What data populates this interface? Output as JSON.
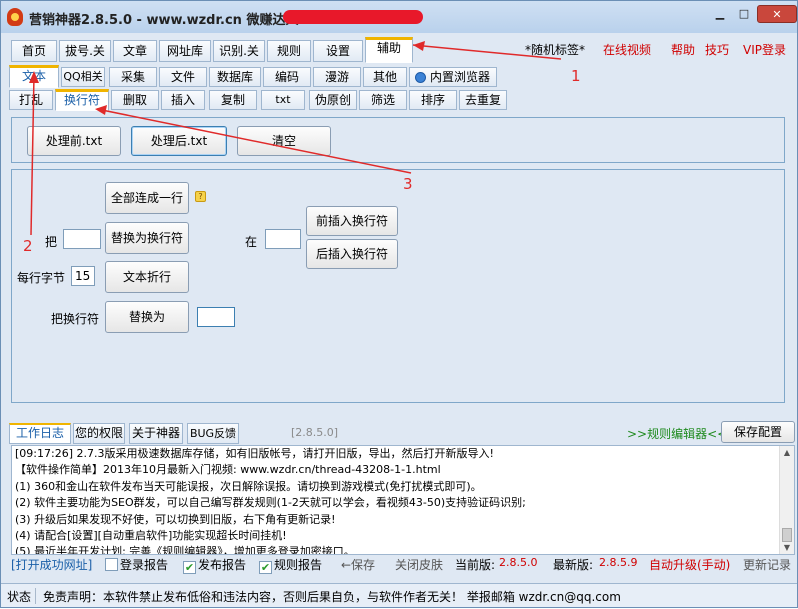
{
  "title": {
    "app": "营销神器2.8.5.0 - www.wzdr.cn 微赚达人.CN"
  },
  "window_buttons": {
    "min": "▁",
    "max": "□",
    "close": "✕"
  },
  "menu": {
    "tabs": [
      "首页",
      "拔号.关",
      "文章",
      "网址库",
      "识别.关",
      "规则",
      "设置",
      "辅助"
    ],
    "random_tag": "*随机标签*",
    "online_video": "在线视频",
    "help": "帮助",
    "tips": "技巧",
    "vip": "VIP登录"
  },
  "subtabs": [
    "文本",
    "QQ相关",
    "采集",
    "文件",
    "数据库",
    "编码",
    "漫游",
    "其他",
    "内置浏览器"
  ],
  "tools": [
    "打乱",
    "换行符",
    "删取",
    "插入",
    "复制",
    "txt",
    "伪原创",
    "筛选",
    "排序",
    "去重复"
  ],
  "panel1": {
    "before": "处理前.txt",
    "after": "处理后.txt",
    "clear": "清空"
  },
  "panel2": {
    "join_all": "全部连成一行",
    "help_icon": "?",
    "ba": "把",
    "ba_value": "",
    "replace_newline": "替换为换行符",
    "zai": "在",
    "zai_value": "",
    "insert_before": "前插入换行符",
    "insert_after": "后插入换行符",
    "bytes_label": "每行字节",
    "bytes_value": "15",
    "wrap": "文本折行",
    "newline_label": "把换行符",
    "replace_with": "替换为",
    "replace_value": ""
  },
  "annotations": {
    "a1": "1",
    "a2": "2",
    "a3": "3"
  },
  "log": {
    "tabs": [
      "工作日志",
      "您的权限",
      "关于神器",
      "BUG反馈"
    ],
    "version_tag": "[2.8.5.0]",
    "rule_editor": ">>规则编辑器<<",
    "save_config": "保存配置",
    "lines": [
      "[09:17:26] 2.7.3版采用极速数据库存储，如有旧版帐号，请打开旧版，导出，然后打开新版导入!",
      "【软件操作简单】2013年10月最新入门视频: www.wzdr.cn/thread-43208-1-1.html",
      "(1) 360和金山在软件发布当天可能误报，次日解除误报。请切换到游戏模式(免打扰模式即可)。",
      "(2) 软件主要功能为SEO群发，可以自己编写群发规则(1-2天就可以学会，看视频43-50)支持验证码识别;",
      "(3) 升级后如果发现不好使，可以切换到旧版，右下角有更新记录!",
      "(4) 请配合[设置][自动重启软件]功能实现超长时间挂机!",
      "(5) 最近半年开发计划: 完善《规则编辑器》，增加更多登录加密接口。"
    ]
  },
  "bottom": {
    "open_success": "[打开成功网址]",
    "login_report": "登录报告",
    "publish_report": "发布报告",
    "rule_report": "规则报告",
    "save": "←保存",
    "close_skin": "关闭皮肤",
    "current_label": "当前版:",
    "current_version": "2.8.5.0",
    "latest_label": "最新版:",
    "latest_version": "2.8.5.9",
    "auto_upgrade": "自动升级(手动)",
    "changelog": "更新记录"
  },
  "status": {
    "label": "状态",
    "disclaimer": "免责声明：本软件禁止发布低俗和违法内容，否则后果自负，与软件作者无关！ 举报邮箱 wzdr.cn@qq.com"
  }
}
